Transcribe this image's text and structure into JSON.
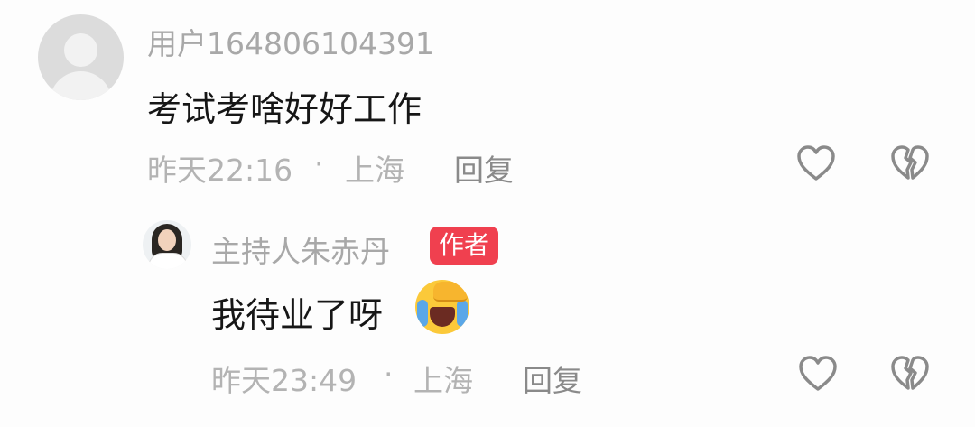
{
  "comment": {
    "username": "用户164806104391",
    "text": "考试考啥好好工作",
    "time": "昨天22:16",
    "separator": "·",
    "location": "上海",
    "reply_label": "回复",
    "icons": {
      "like": "heart-outline-icon",
      "dislike": "broken-heart-icon"
    }
  },
  "reply": {
    "username": "主持人朱赤丹",
    "badge": "作者",
    "text": "我待业了呀",
    "emoji": "laughing-crying-emoji",
    "time": "昨天23:49",
    "separator": "·",
    "location": "上海",
    "reply_label": "回复",
    "icons": {
      "like": "heart-outline-icon",
      "dislike": "broken-heart-icon"
    },
    "badge_color": "#f0404f"
  }
}
